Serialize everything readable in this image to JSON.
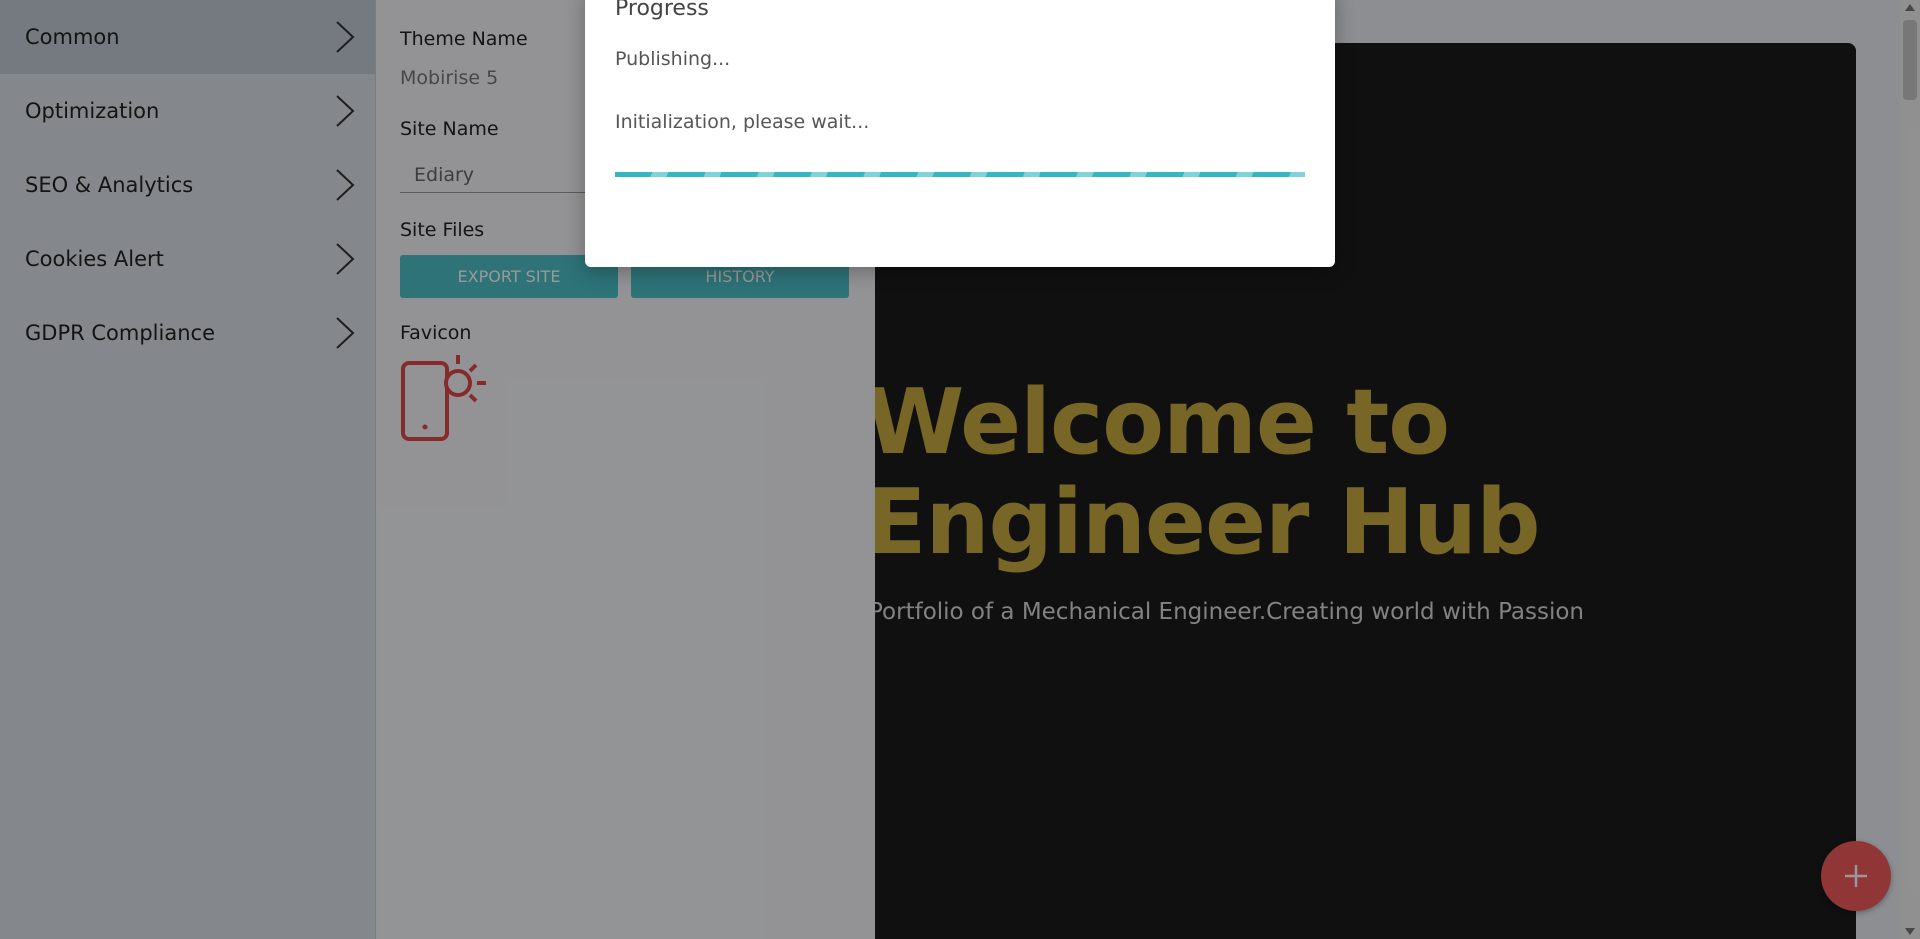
{
  "sidebar": {
    "items": [
      {
        "label": "Common",
        "active": true
      },
      {
        "label": "Optimization",
        "active": false
      },
      {
        "label": "SEO & Analytics",
        "active": false
      },
      {
        "label": "Cookies Alert",
        "active": false
      },
      {
        "label": "GDPR Compliance",
        "active": false
      }
    ]
  },
  "settings": {
    "theme_label": "Theme Name",
    "theme_value": "Mobirise 5",
    "site_name_label": "Site Name",
    "site_name_value": "Ediary",
    "site_files_label": "Site Files",
    "export_button": "EXPORT SITE",
    "history_button": "HISTORY",
    "favicon_label": "Favicon",
    "favicon_icon": "phone-sun-icon"
  },
  "preview": {
    "hero_line1": "Welcome to",
    "hero_line2": "Engineer Hub",
    "hero_subtitle": "Portfolio of a Mechanical Engineer.Creating world with Passion"
  },
  "modal": {
    "title": "Progress",
    "status": "Publishing...",
    "message": "Initialization, please wait...",
    "progress": 1.0
  },
  "fab": {
    "icon": "plus-icon"
  },
  "colors": {
    "accent": "#4bc0c8",
    "hero_text": "#c9ab40",
    "fab": "#f05a5a",
    "favicon": "#e04848"
  }
}
